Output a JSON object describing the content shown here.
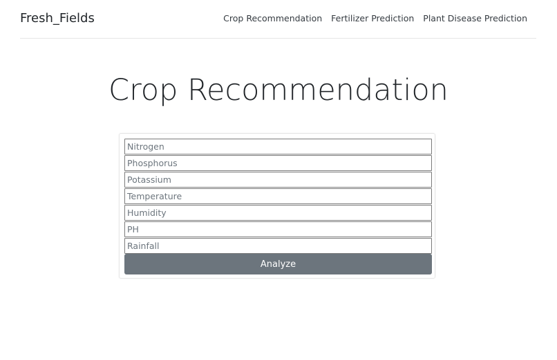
{
  "navbar": {
    "brand": "Fresh_Fields",
    "links": [
      {
        "label": "Crop Recommendation"
      },
      {
        "label": "Fertilizer Prediction"
      },
      {
        "label": "Plant Disease Prediction"
      }
    ]
  },
  "main": {
    "title": "Crop Recommendation",
    "form": {
      "fields": [
        {
          "placeholder": "Nitrogen",
          "value": ""
        },
        {
          "placeholder": "Phosphorus",
          "value": ""
        },
        {
          "placeholder": "Potassium",
          "value": ""
        },
        {
          "placeholder": "Temperature",
          "value": ""
        },
        {
          "placeholder": "Humidity",
          "value": ""
        },
        {
          "placeholder": "PH",
          "value": ""
        },
        {
          "placeholder": "Rainfall",
          "value": ""
        }
      ],
      "submit_label": "Analyze"
    }
  },
  "colors": {
    "button_background": "#6c757d",
    "button_text": "#ffffff",
    "divider": "#e5e5e5"
  }
}
